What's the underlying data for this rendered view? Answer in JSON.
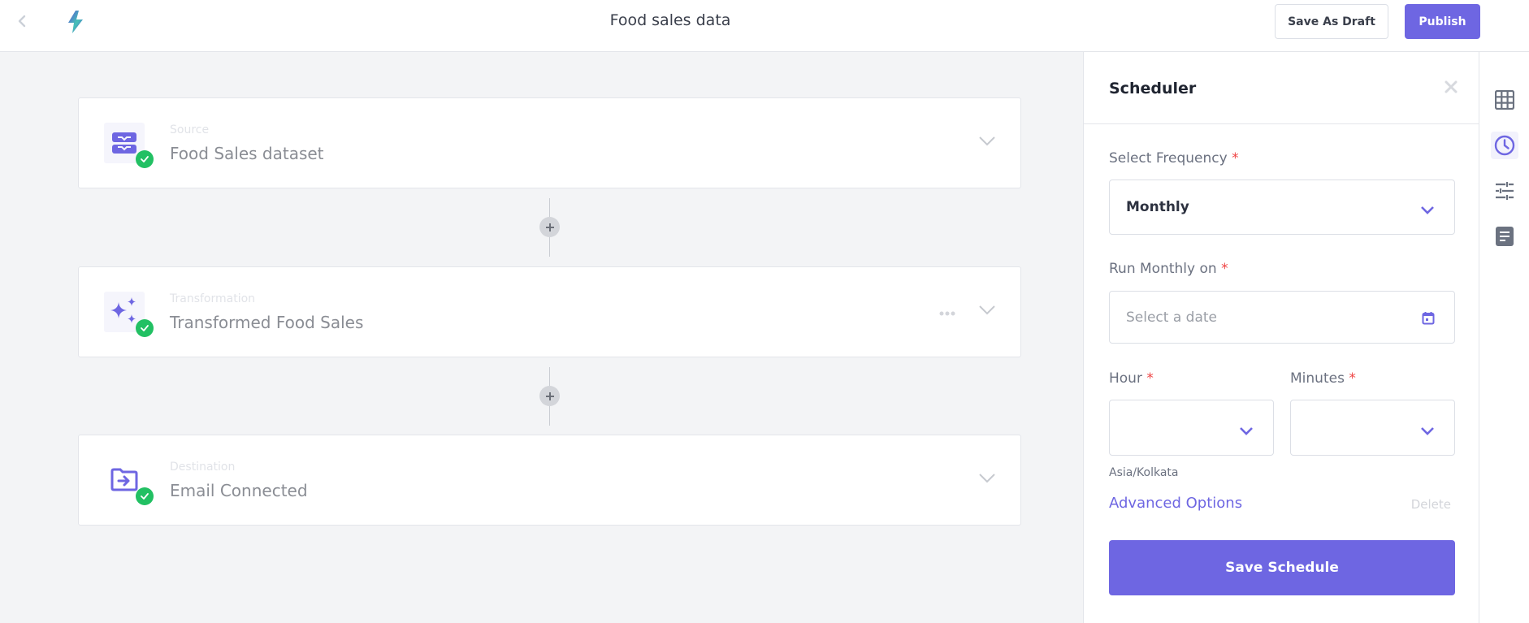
{
  "header": {
    "back_icon": "chevron-left-icon",
    "logo_icon": "lightning-bolt-logo",
    "title": "Food sales data",
    "save_draft_label": "Save As Draft",
    "publish_label": "Publish"
  },
  "pipeline": {
    "steps": [
      {
        "kind": "Source",
        "name": "Food Sales dataset",
        "icon": "inbox-tray-icon",
        "status": "complete",
        "has_more_menu": false
      },
      {
        "kind": "Transformation",
        "name": "Transformed Food Sales",
        "icon": "sparkles-icon",
        "status": "complete",
        "has_more_menu": true
      },
      {
        "kind": "Destination",
        "name": "Email Connected",
        "icon": "folder-arrow-icon",
        "status": "complete",
        "has_more_menu": false
      }
    ],
    "connector_icon": "plus-icon",
    "more_icon": "ellipsis-icon"
  },
  "scheduler": {
    "title": "Scheduler",
    "close_icon": "close-icon",
    "frequency": {
      "label": "Select Frequency",
      "required_mark": "*",
      "value": "Monthly"
    },
    "run_on": {
      "label": "Run Monthly on",
      "required_mark": "*",
      "placeholder": "Select a date",
      "icon": "calendar-icon"
    },
    "hour": {
      "label": "Hour",
      "required_mark": "*",
      "value": ""
    },
    "minutes": {
      "label": "Minutes",
      "required_mark": "*",
      "value": ""
    },
    "timezone": "Asia/Kolkata",
    "advanced_options_label": "Advanced Options",
    "delete_label": "Delete",
    "save_label": "Save Schedule"
  },
  "rail": {
    "items": [
      {
        "icon": "table-grid-icon",
        "active": false
      },
      {
        "icon": "clock-icon",
        "active": true
      },
      {
        "icon": "sliders-icon",
        "active": false
      },
      {
        "icon": "document-icon",
        "active": false
      }
    ]
  },
  "colors": {
    "accent": "#6e66e2",
    "success": "#22c063",
    "required": "#ef4444",
    "background": "#f3f4f6"
  }
}
